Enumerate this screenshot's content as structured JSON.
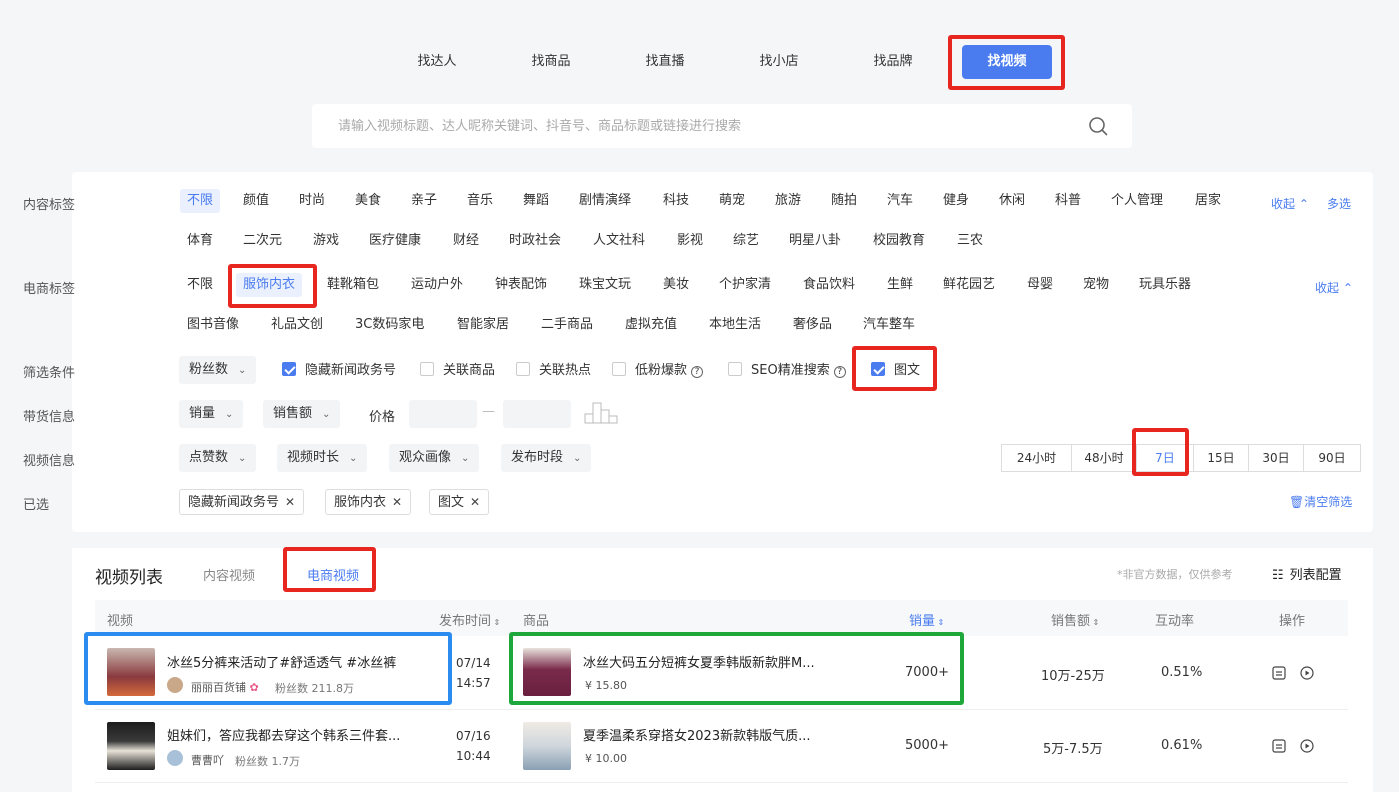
{
  "top_nav": [
    "找达人",
    "找商品",
    "找直播",
    "找小店",
    "找品牌",
    "找视频"
  ],
  "search": {
    "placeholder": "请输入视频标题、达人昵称关键词、抖音号、商品标题或链接进行搜索"
  },
  "content_tags": {
    "label": "内容标签",
    "row1": [
      "不限",
      "颜值",
      "时尚",
      "美食",
      "亲子",
      "音乐",
      "舞蹈",
      "剧情演绎",
      "科技",
      "萌宠",
      "旅游",
      "随拍",
      "汽车",
      "健身",
      "休闲",
      "科普",
      "个人管理",
      "居家"
    ],
    "row2": [
      "体育",
      "二次元",
      "游戏",
      "医疗健康",
      "财经",
      "时政社会",
      "人文社科",
      "影视",
      "综艺",
      "明星八卦",
      "校园教育",
      "三农"
    ],
    "collapse": "收起",
    "multi": "多选"
  },
  "ecom_tags": {
    "label": "电商标签",
    "row1": [
      "不限",
      "服饰内衣",
      "鞋靴箱包",
      "运动户外",
      "钟表配饰",
      "珠宝文玩",
      "美妆",
      "个护家清",
      "食品饮料",
      "生鲜",
      "鲜花园艺",
      "母婴",
      "宠物",
      "玩具乐器"
    ],
    "row2": [
      "图书音像",
      "礼品文创",
      "3C数码家电",
      "智能家居",
      "二手商品",
      "虚拟充值",
      "本地生活",
      "奢侈品",
      "汽车整车"
    ],
    "collapse": "收起"
  },
  "filters": {
    "label": "筛选条件",
    "fans_dropdown": "粉丝数",
    "checkboxes": [
      {
        "label": "隐藏新闻政务号",
        "checked": true
      },
      {
        "label": "关联商品",
        "checked": false
      },
      {
        "label": "关联热点",
        "checked": false
      },
      {
        "label": "低粉爆款",
        "checked": false
      },
      {
        "label": "SEO精准搜索",
        "checked": false
      },
      {
        "label": "图文",
        "checked": true
      }
    ]
  },
  "sales_info": {
    "label": "带货信息",
    "sales_volume": "销量",
    "sales_amount": "销售额",
    "price_label": "价格",
    "dash": "—"
  },
  "video_info": {
    "label": "视频信息",
    "dropdowns": [
      "点赞数",
      "视频时长",
      "观众画像",
      "发布时段"
    ],
    "time_ranges": [
      "24小时",
      "48小时",
      "7日",
      "15日",
      "30日",
      "90日"
    ],
    "active_range": "7日"
  },
  "selected": {
    "label": "已选",
    "chips": [
      "隐藏新闻政务号",
      "服饰内衣",
      "图文"
    ],
    "clear": "清空筛选"
  },
  "list": {
    "title": "视频列表",
    "tabs": [
      "内容视频",
      "电商视频"
    ],
    "note": "*非官方数据，仅供参考",
    "config": "列表配置",
    "headers": [
      "视频",
      "发布时间",
      "商品",
      "销量",
      "销售额",
      "互动率",
      "操作"
    ],
    "rows": [
      {
        "video_title": "冰丝5分裤来活动了#舒适透气 #冰丝裤",
        "author": "丽丽百货铺",
        "fans": "粉丝数 211.8万",
        "date": "07/14",
        "time": "14:57",
        "product_title": "冰丝大码五分短裤女夏季韩版新款胖M...",
        "price": "¥ 15.80",
        "sales": "7000+",
        "amount": "10万-25万",
        "rate": "0.51%"
      },
      {
        "video_title": "姐妹们，答应我都去穿这个韩系三件套...",
        "author": "曹曹吖",
        "fans": "粉丝数 1.7万",
        "date": "07/16",
        "time": "10:44",
        "product_title": "夏季温柔系穿搭女2023新款韩版气质...",
        "price": "¥ 10.00",
        "sales": "5000+",
        "amount": "5万-7.5万",
        "rate": "0.61%"
      }
    ]
  },
  "colors": {
    "accent": "#4a7cf0",
    "highlight_red": "#e6261f",
    "highlight_blue": "#2b8cf0",
    "highlight_green": "#1ea83c"
  }
}
